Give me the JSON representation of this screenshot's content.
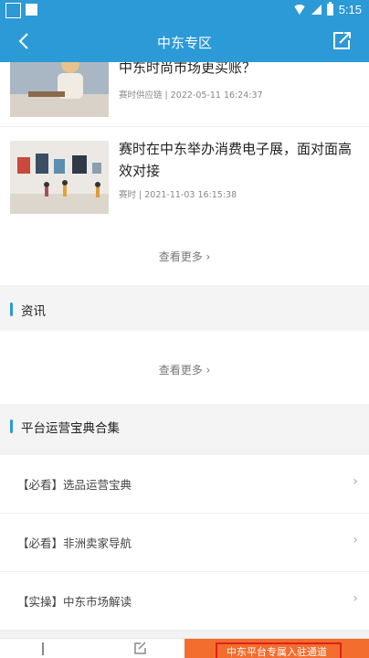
{
  "status_bar": {
    "time": "5:15"
  },
  "nav": {
    "title": "中东专区"
  },
  "articles": [
    {
      "title": "中东时尚市场更买账？",
      "meta": "赛时供应链 | 2022-05-11 16:24:37"
    },
    {
      "title": "赛时在中东举办消费电子展，面对面高效对接",
      "meta": "赛时 | 2021-11-03 16:15:38"
    }
  ],
  "more_label_1": "查看更多 ›",
  "section_news": {
    "title": "资讯",
    "more_label": "查看更多 ›"
  },
  "section_guides": {
    "title": "平台运营宝典合集",
    "items": [
      {
        "label": "【必看】选品运营宝典"
      },
      {
        "label": "【必看】非洲卖家导航"
      },
      {
        "label": "【实操】中东市场解读"
      }
    ]
  },
  "bottom": {
    "cta_label": "中东平台专属入驻通道"
  },
  "colors": {
    "primary": "#2b9ad6",
    "cta": "#f36d2e"
  }
}
